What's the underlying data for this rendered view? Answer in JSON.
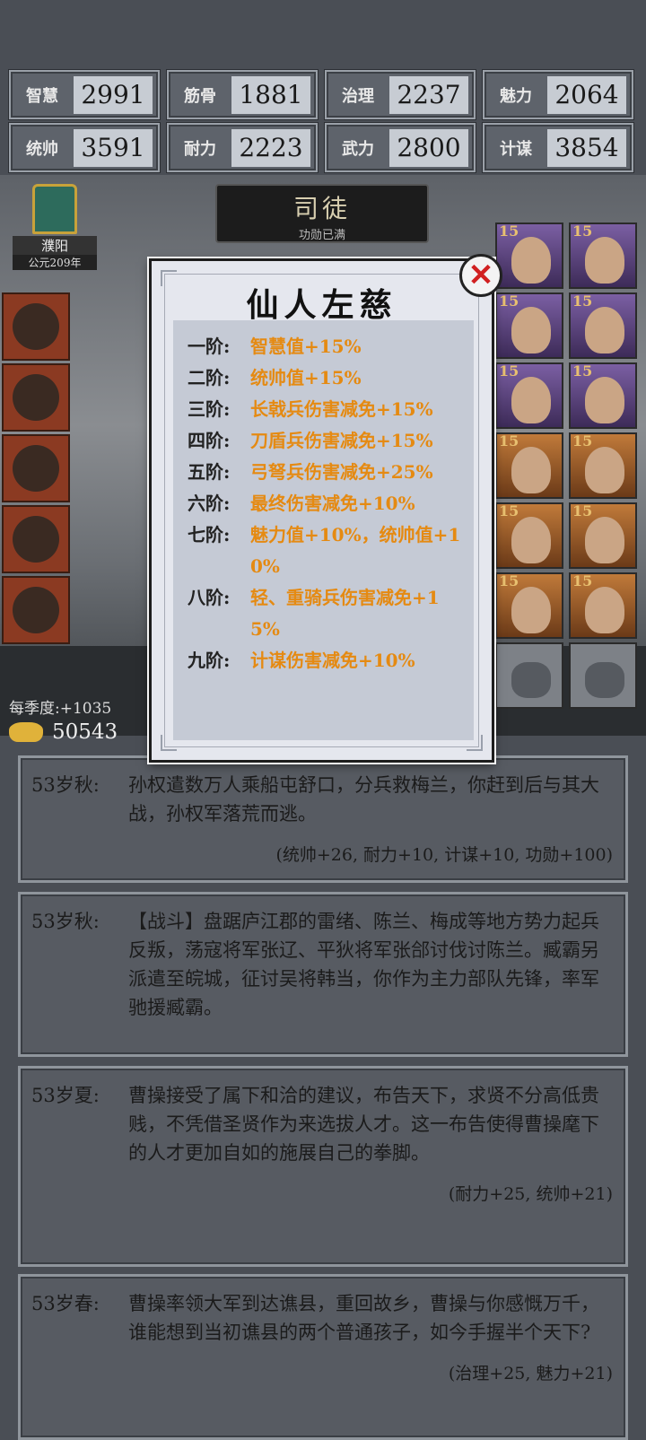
{
  "stats": [
    {
      "label": "智慧",
      "value": "2991"
    },
    {
      "label": "筋骨",
      "value": "1881"
    },
    {
      "label": "治理",
      "value": "2237"
    },
    {
      "label": "魅力",
      "value": "2064"
    },
    {
      "label": "统帅",
      "value": "3591"
    },
    {
      "label": "耐力",
      "value": "2223"
    },
    {
      "label": "武力",
      "value": "2800"
    },
    {
      "label": "计谋",
      "value": "3854"
    }
  ],
  "office": {
    "title": "司徒",
    "subtitle": "功勋已满"
  },
  "city": {
    "name": "濮阳",
    "year": "公元209年"
  },
  "portrait_level": "15",
  "economy": {
    "income": "每季度:+1035",
    "gold": "50543"
  },
  "modal": {
    "title": "仙人左慈",
    "close_icon": "close-x-icon",
    "tiers": [
      {
        "level": "一阶:",
        "effect": "智慧值+15%"
      },
      {
        "level": "二阶:",
        "effect": "统帅值+15%"
      },
      {
        "level": "三阶:",
        "effect": "长戟兵伤害减免+15%"
      },
      {
        "level": "四阶:",
        "effect": "刀盾兵伤害减免+15%"
      },
      {
        "level": "五阶:",
        "effect": "弓弩兵伤害减免+25%"
      },
      {
        "level": "六阶:",
        "effect": "最终伤害减免+10%"
      },
      {
        "level": "七阶:",
        "effect": "魅力值+10%，统帅值+10%"
      },
      {
        "level": "八阶:",
        "effect": "轻、重骑兵伤害减免+15%"
      },
      {
        "level": "九阶:",
        "effect": "计谋伤害减免+10%"
      }
    ]
  },
  "log": [
    {
      "age": "53岁秋:",
      "text": "孙权遣数万人乘船屯舒口，分兵救梅兰，你赶到后与其大战，孙权军落荒而逃。",
      "reward": "(统帅+26, 耐力+10, 计谋+10, 功勋+100)"
    },
    {
      "age": "53岁秋:",
      "text": "【战斗】盘踞庐江郡的雷绪、陈兰、梅成等地方势力起兵反叛，荡寇将军张辽、平狄将军张郃讨伐讨陈兰。臧霸另派遣至皖城，征讨吴将韩当，你作为主力部队先锋，率军驰援臧霸。",
      "reward": ""
    },
    {
      "age": "53岁夏:",
      "text": "曹操接受了属下和洽的建议，布告天下，求贤不分高低贵贱，不凭借圣贤作为来选拔人才。这一布告使得曹操麾下的人才更加自如的施展自己的拳脚。",
      "reward": "(耐力+25, 统帅+21)"
    },
    {
      "age": "53岁春:",
      "text": "曹操率领大军到达谯县，重回故乡，曹操与你感慨万千，谁能想到当初谯县的两个普通孩子，如今手握半个天下?",
      "reward": "(治理+25, 魅力+21)"
    }
  ]
}
